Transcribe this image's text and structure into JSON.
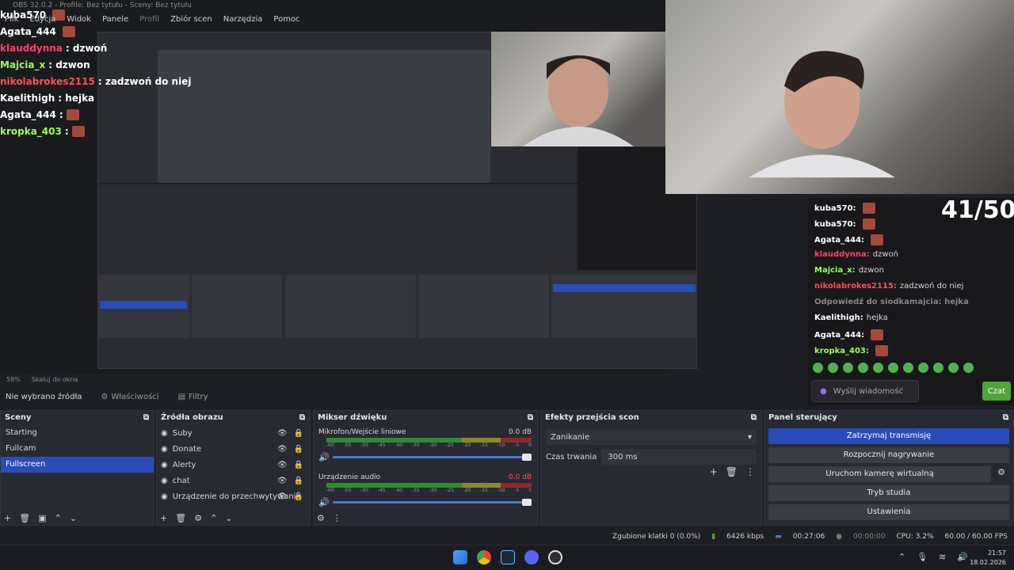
{
  "window": {
    "title": "OBS 32.0.2 - Profile: Bez tytułu - Sceny: Bez tytułu"
  },
  "menu": [
    "Plik",
    "Edycja",
    "Widok",
    "Panele",
    "Profil",
    "Zbiór scen",
    "Narzędzia",
    "Pomoc"
  ],
  "chat_overlay": [
    {
      "user": "kuba570",
      "msg": "",
      "color": "#ffffff"
    },
    {
      "user": "Agata_444",
      "msg": "",
      "color": "#ffffff"
    },
    {
      "user": "klauddynna",
      "msg": ": dzwoń",
      "color": "#ff3f6a"
    },
    {
      "user": "Majcia_x",
      "msg": " : dzwon",
      "color": "#9bff5a"
    },
    {
      "user": "nikolabrokes2115",
      "msg": " : zadzwoń do niej",
      "color": "#ff4f4f"
    },
    {
      "user": "Kaelithigh",
      "msg": " : hejka",
      "color": "#ffffff"
    },
    {
      "user": "Agata_444",
      "msg": " :",
      "color": "#ffffff"
    },
    {
      "user": "kropka_403",
      "msg": " :",
      "color": "#9bff5a"
    }
  ],
  "counter": "41/50",
  "chat_right": [
    {
      "user": "kuba570:",
      "msg": "",
      "color": "#ffffff"
    },
    {
      "user": "kuba570:",
      "msg": "",
      "color": "#ffffff"
    },
    {
      "user": "Agata_444:",
      "msg": "",
      "color": "#ffffff"
    },
    {
      "user": "klauddynna:",
      "msg": "dzwoń",
      "color": "#ff3f6a"
    },
    {
      "user": "Majcia_x:",
      "msg": "dzwon",
      "color": "#9bff5a"
    },
    {
      "user": "nikolabrokes2115:",
      "msg": "zadzwoń do niej",
      "color": "#ff4f4f"
    },
    {
      "user": "Odpowiedź do siodkamajcia: hejka",
      "msg": "",
      "color": "#888888"
    },
    {
      "user": "Kaelithigh:",
      "msg": "hejka",
      "color": "#ffffff"
    },
    {
      "user": "Agata_444:",
      "msg": "",
      "color": "#ffffff"
    },
    {
      "user": "kropka_403:",
      "msg": "",
      "color": "#9bff5a"
    }
  ],
  "chat_input": {
    "placeholder": "Wyślij wiadomość",
    "send": "Czat"
  },
  "zoom": {
    "level": "59%",
    "mode": "Skaluj do okna"
  },
  "source_bar": {
    "none": "Nie wybrano źródła",
    "properties": "Właściwości",
    "filters": "Filtry"
  },
  "scenes": {
    "title": "Sceny",
    "items": [
      "Starting",
      "Fullcam",
      "Fullscreen"
    ],
    "selected": 2
  },
  "sources": {
    "title": "Źródła obrazu",
    "items": [
      "Suby",
      "Donate",
      "Alerty",
      "chat",
      "Urządzenie do przechwytywania"
    ]
  },
  "mixer": {
    "title": "Mikser dźwięku",
    "channels": [
      {
        "name": "Mikrofon/Wejście liniowe",
        "db": "0.0 dB"
      },
      {
        "name": "Urządzenie audio",
        "db": "0.0 dB"
      }
    ],
    "ticks": [
      "-60",
      "-55",
      "-50",
      "-45",
      "-40",
      "-35",
      "-30",
      "-25",
      "-20",
      "-15",
      "-10",
      "-5",
      "0"
    ]
  },
  "transitions": {
    "title": "Efekty przejścia scon",
    "effect": "Zanikanie",
    "duration_label": "Czas trwania",
    "duration": "300 ms"
  },
  "controls": {
    "title": "Panel sterujący",
    "buttons": [
      "Zatrzymaj transmisję",
      "Rozpocznij nagrywanie",
      "Uruchom kamerę wirtualną",
      "Tryb studia",
      "Ustawienia"
    ]
  },
  "status": {
    "dropped": "Zgubione klatki 0 (0.0%)",
    "bitrate": "6426 kbps",
    "stream_time": "00:27:06",
    "rec_time": "00:00:00",
    "cpu": "CPU: 3.2%",
    "fps": "60.00 / 60.00 FPS"
  },
  "clock": {
    "time": "21:57",
    "date": "18.02.2026"
  },
  "colors": {
    "accent": "#284cb8",
    "send": "#53a33b"
  }
}
